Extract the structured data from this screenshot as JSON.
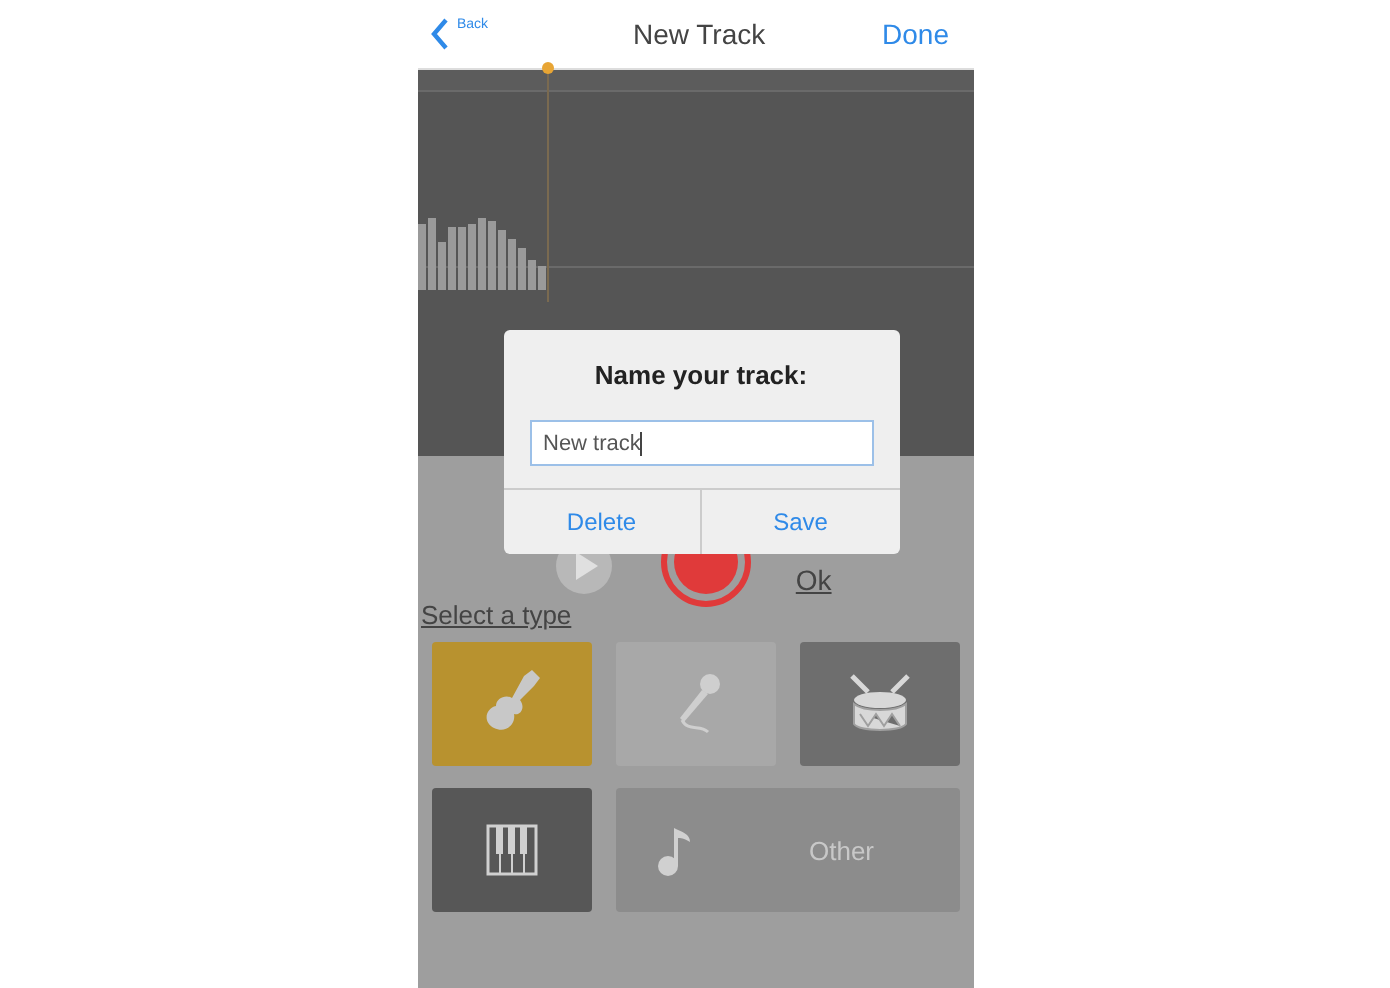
{
  "nav": {
    "back": "Back",
    "title": "New Track",
    "done": "Done"
  },
  "controls": {
    "ok": "Ok"
  },
  "section_title": "Select a type",
  "types": [
    {
      "kind": "guitar",
      "color": "#b8922f"
    },
    {
      "kind": "mic",
      "color": "#a8a8a8"
    },
    {
      "kind": "drum",
      "color": "#6e6e6e"
    },
    {
      "kind": "piano",
      "color": "#575757"
    },
    {
      "kind": "note",
      "color": "#8c8c8c",
      "label": "Other"
    }
  ],
  "dialog": {
    "title": "Name your track:",
    "value": "New track",
    "buttons": [
      "Delete",
      "Save"
    ]
  }
}
